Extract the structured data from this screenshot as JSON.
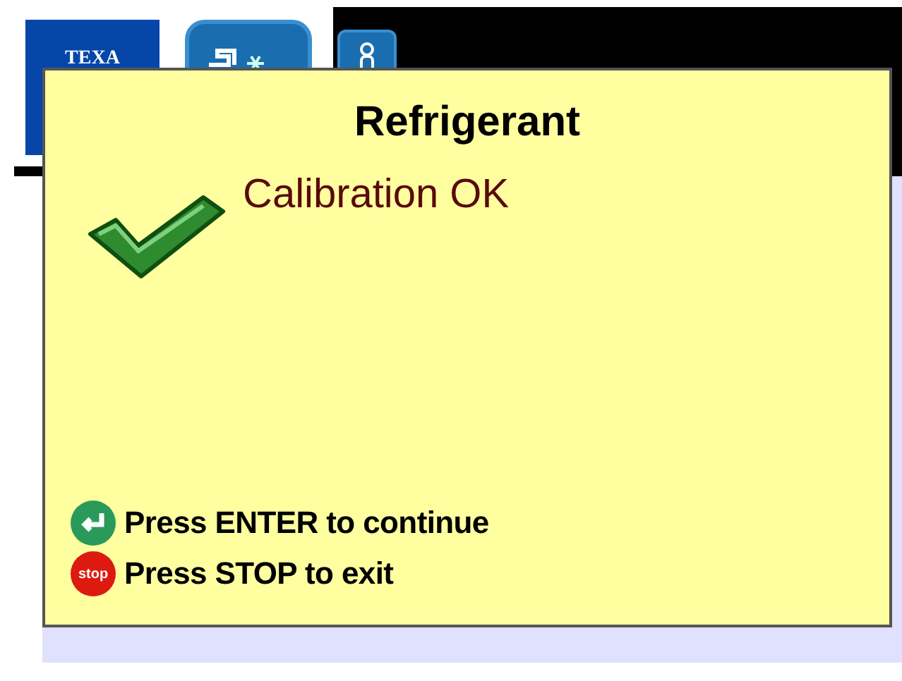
{
  "header": {
    "logo": "TEXA"
  },
  "dialog": {
    "title": "Refrigerant",
    "kind": "success",
    "message": "Calibration OK",
    "actions": [
      {
        "kind": "enter",
        "label": "Press ENTER to continue"
      },
      {
        "kind": "stop",
        "key_text": "stop",
        "label": "Press STOP to exit"
      }
    ]
  }
}
